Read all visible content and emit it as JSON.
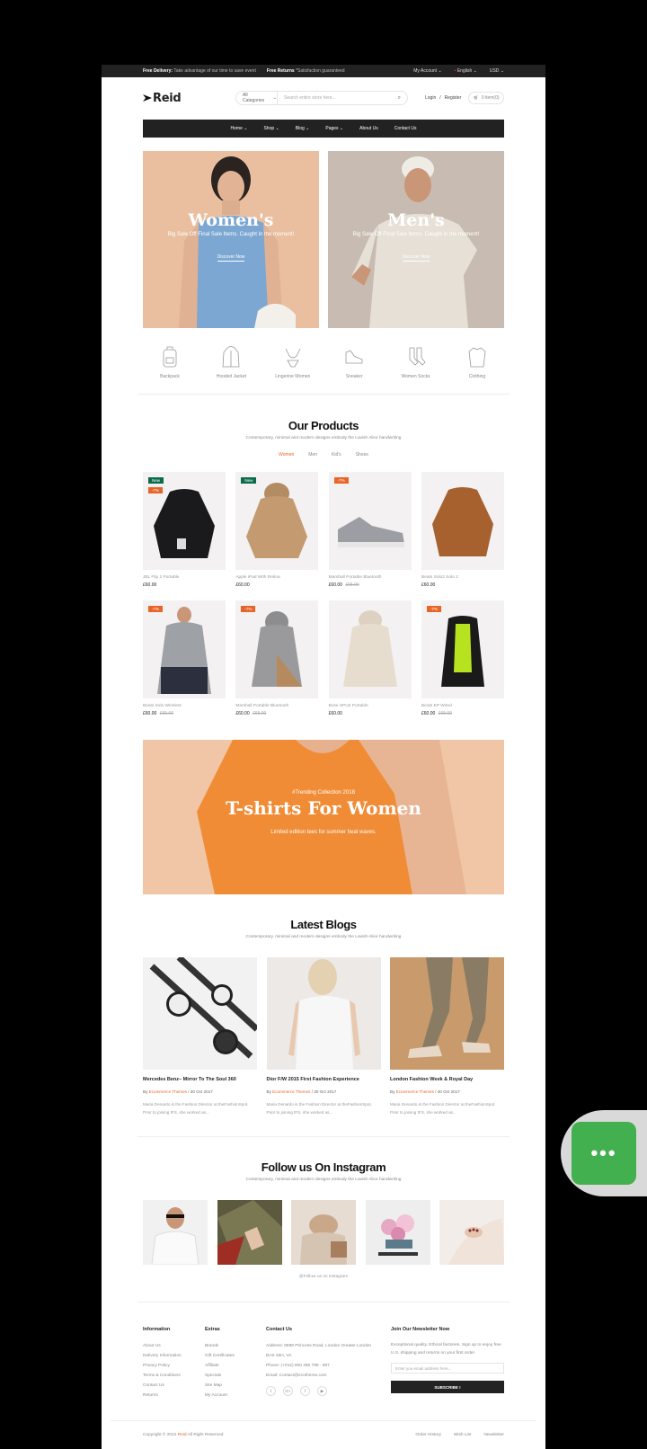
{
  "topbar": {
    "delivery_label": "Free Delivery:",
    "delivery_text": "Take advantage of our time to save event",
    "returns_label": "Free Returns",
    "returns_text": "Satisfaction guaranteed",
    "account": "My Account",
    "language": "English",
    "currency": "USD"
  },
  "header": {
    "logo": "Reid",
    "category": "All Categories",
    "search_placeholder": "Search entire store here...",
    "login": "Login",
    "register": "Register",
    "cart": "0 item(0)"
  },
  "nav": [
    "Home",
    "Shop",
    "Blog",
    "Pages",
    "About Us",
    "Contact Us"
  ],
  "banners": [
    {
      "title": "Women's",
      "subtitle": "Big Sale Off Final Sale Items. Caught in the moment!",
      "cta": "Discover Now"
    },
    {
      "title": "Men's",
      "subtitle": "Big Sale Off Final Sale Items. Caught in the moment!",
      "cta": "Discover Now"
    }
  ],
  "categories": [
    {
      "label": "Backpack",
      "icon": "backpack-icon"
    },
    {
      "label": "Hooded Jacket",
      "icon": "hooded-jacket-icon"
    },
    {
      "label": "Lingerine Women",
      "icon": "lingerie-icon"
    },
    {
      "label": "Sneaker",
      "icon": "sneaker-icon"
    },
    {
      "label": "Women Socks",
      "icon": "socks-icon"
    },
    {
      "label": "Clothing",
      "icon": "shirt-icon"
    }
  ],
  "products_section": {
    "title": "Our Products",
    "subtitle": "Contemporary, minimal and modern designs embody the Lavish Alice handwriting",
    "tabs": [
      "Women",
      "Men",
      "Kid's",
      "Shoes"
    ]
  },
  "products_row1": [
    {
      "name": "JBL Flip 2 Portable",
      "price": "£60.00",
      "old": "",
      "badges": [
        "New",
        "-7%"
      ]
    },
    {
      "name": "Apple iPad With Retina",
      "price": "£60.00",
      "old": "",
      "badges": [
        "New"
      ]
    },
    {
      "name": "Marshall Portable Bluetooth",
      "price": "£60.00",
      "old": "£65.00",
      "badges": [
        "-7%"
      ]
    },
    {
      "name": "Beats Solo2 Solo 2",
      "price": "£60.00",
      "old": "",
      "badges": []
    }
  ],
  "products_row2": [
    {
      "name": "Beats Solo Wireless",
      "price": "£60.00",
      "old": "£65.00",
      "badges": [
        "-7%"
      ]
    },
    {
      "name": "Marshall Portable Bluetooth",
      "price": "£60.00",
      "old": "£65.00",
      "badges": [
        "-7%"
      ]
    },
    {
      "name": "Bose SPU2 Portable",
      "price": "£60.00",
      "old": "",
      "badges": []
    },
    {
      "name": "Beats EP Wired",
      "price": "£60.00",
      "old": "£65.00",
      "badges": [
        "-7%"
      ]
    }
  ],
  "promo": {
    "kicker": "#Trending Collection 2018",
    "title": "T-shirts For Women",
    "subtitle": "Limited edition tees for summer heat waves."
  },
  "blogs_section": {
    "title": "Latest Blogs",
    "subtitle": "Contemporary, minimal and modern designs embody the Lavish Alice handwriting"
  },
  "blogs": [
    {
      "title": "Mercedes Benz– Mirror To The Soul 360",
      "by": "By",
      "author": "Ecommerce Themes",
      "date": " / 30 Oct 2017",
      "excerpt": "Maria Denardo is the Fashion Director at theFashionSpot. Prior to joining tFS, she worked as..."
    },
    {
      "title": "Dior F/W 2015 First Fashion Experience",
      "by": "By",
      "author": "Ecommerce Themes",
      "date": " / 30 Oct 2017",
      "excerpt": "Maria Denardo is the Fashion Director at theFashionSpot. Prior to joining tFS, she worked as..."
    },
    {
      "title": "London Fashion Week & Royal Day",
      "by": "By",
      "author": "Ecommerce Themes",
      "date": " / 30 Oct 2017",
      "excerpt": "Maria Denardo is the Fashion Director at theFashionSpot. Prior to joining tFS, she worked as..."
    }
  ],
  "instagram": {
    "title": "Follow us On Instagram",
    "subtitle": "Contemporary, minimal and modern designs embody the Lavish Alice handwriting",
    "link": "@Follow us on Instagram"
  },
  "footer": {
    "information": {
      "title": "Information",
      "links": [
        "About Us",
        "Delivery Information",
        "Privacy Policy",
        "Terms & Conditions",
        "Contact Us",
        "Returns"
      ]
    },
    "extras": {
      "title": "Extras",
      "links": [
        "Brands",
        "Gift Certificates",
        "Affiliate",
        "Specials",
        "Site Map",
        "My Account"
      ]
    },
    "contact": {
      "title": "Contact Us",
      "lines": [
        "Address: 8698 Princess Road, London Greater London",
        "BAS 46H, VA",
        "Phone: (+012) 800 456 789 - 987",
        "Email: Contact@ecotheme.com"
      ]
    },
    "newsletter": {
      "title": "Join Our Newsletter Now",
      "text": "Exceptional quality. Ethical factories. Sign up to enjoy free U.S. shipping and returns on your first order.",
      "placeholder": "Enter you email address here...",
      "button": "SUBSCRIBE !"
    }
  },
  "copyright": {
    "prefix": "Copyright © 2021 ",
    "brand": "Reid",
    "suffix": " All Right Reserved",
    "links": [
      "Order History",
      "Wish List",
      "Newsletter"
    ]
  },
  "colors": {
    "accent": "#e8652a",
    "dark": "#222222",
    "new_badge": "#0c6b4a",
    "chat": "#43b04f"
  }
}
